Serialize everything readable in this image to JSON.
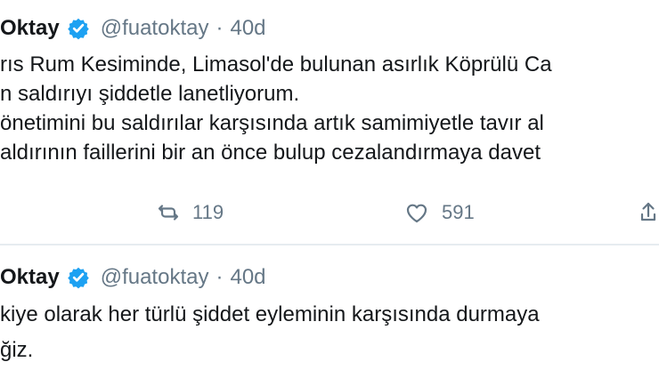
{
  "tweets": [
    {
      "name": "Oktay",
      "handle": "@fuatoktay",
      "dot": "·",
      "time": "40d",
      "lines": [
        "rıs Rum Kesiminde, Limasol'de bulunan asırlık Köprülü Ca",
        "n saldırıyı şiddetle lanetliyorum.",
        "önetimini bu saldırılar karşısında artık samimiyetle tavır al",
        "aldırının faillerini bir an önce bulup cezalandırmaya davet"
      ],
      "retweets": "119",
      "likes": "591"
    },
    {
      "name": "Oktay",
      "handle": "@fuatoktay",
      "dot": "·",
      "time": "40d",
      "lines": [
        "kiye olarak her türlü şiddet eyleminin karşısında durmaya",
        "ğiz."
      ]
    }
  ],
  "icons": {
    "verified": "verified-badge-icon",
    "retweet": "retweet-icon",
    "like": "heart-icon",
    "share": "share-icon"
  },
  "colors": {
    "verified_blue": "#1da1f2",
    "secondary_text": "#657786",
    "divider": "#e6ecf0"
  }
}
